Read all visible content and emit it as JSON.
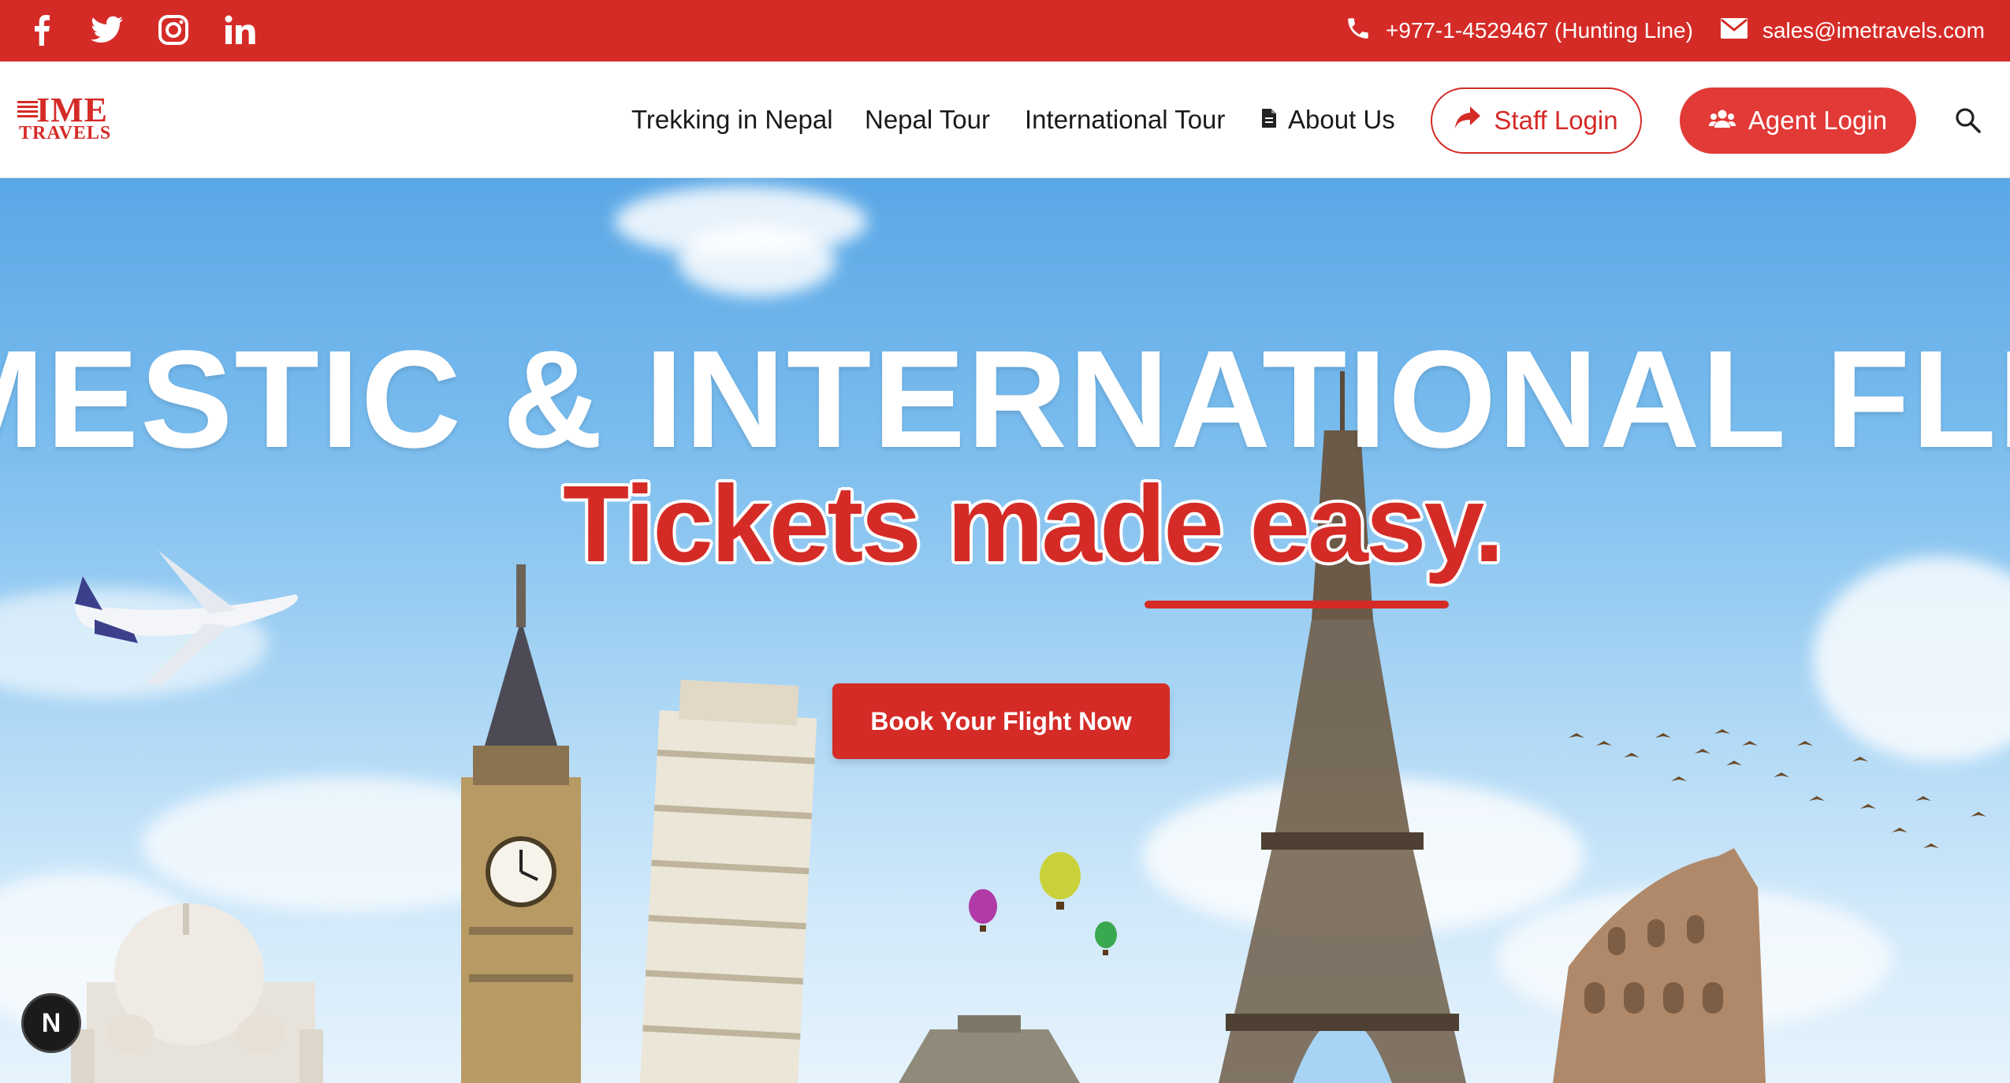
{
  "topbar": {
    "social": [
      {
        "icon": "facebook-icon"
      },
      {
        "icon": "twitter-icon"
      },
      {
        "icon": "instagram-icon"
      },
      {
        "icon": "linkedin-icon"
      }
    ],
    "phone": "+977-1-4529467 (Hunting Line)",
    "email": "sales@imetravels.com",
    "color": "#d52b27"
  },
  "logo": {
    "line1": "IME",
    "line2": "TRAVELS"
  },
  "nav": {
    "items": [
      "Trekking in Nepal",
      "Nepal Tour",
      "International Tour",
      "About Us"
    ],
    "staff_login": "Staff Login",
    "agent_login": "Agent Login"
  },
  "hero": {
    "headline": "MESTIC & INTERNATIONAL FLIGH",
    "tagline": "Tickets made easy.",
    "cta": "Book Your Flight Now",
    "badge": "N"
  }
}
